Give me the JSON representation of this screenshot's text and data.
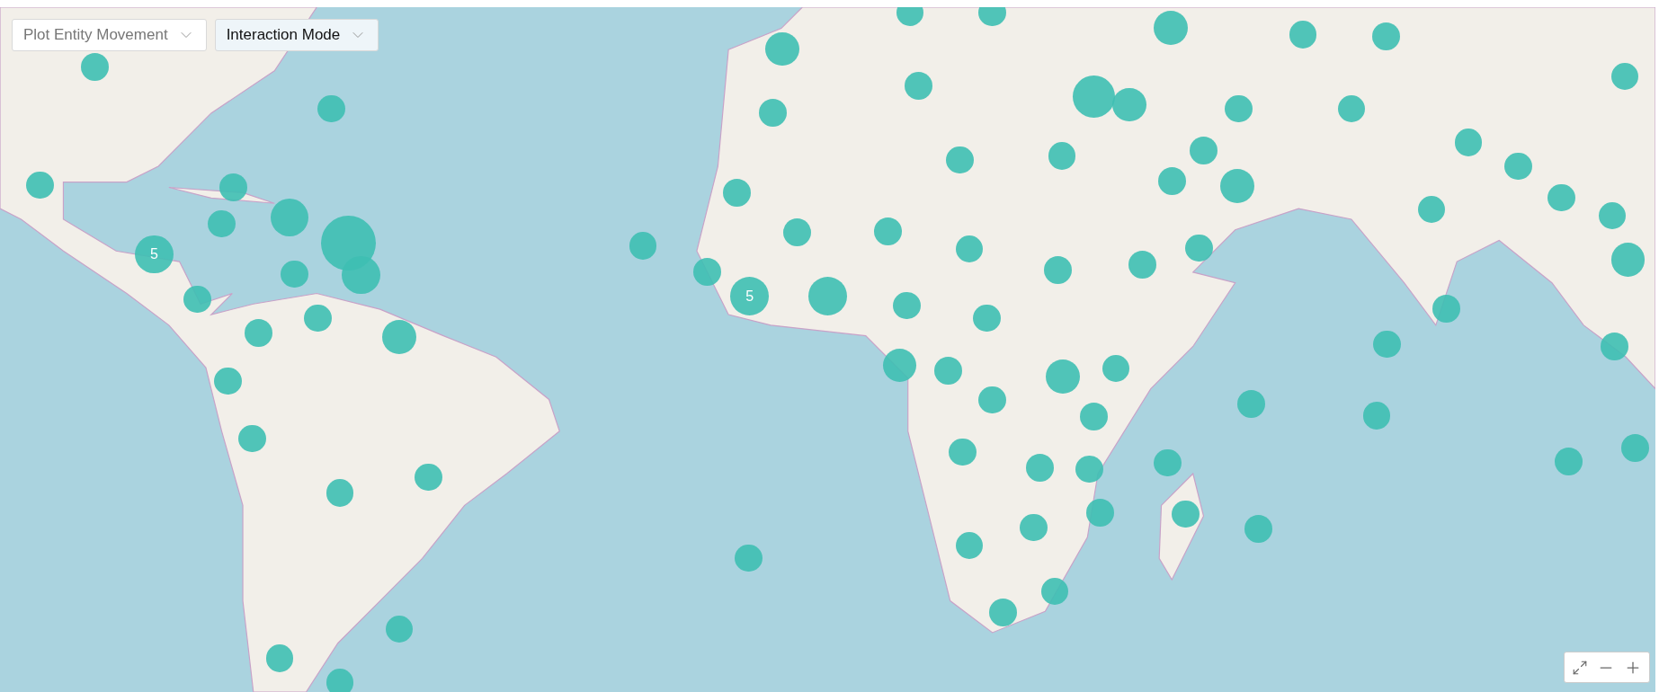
{
  "toolbar": [
    {
      "label": "Plot Entity Movement",
      "kind": "placeholder"
    },
    {
      "label": "Interaction Mode",
      "kind": "value"
    }
  ],
  "clusters": [
    {
      "label": "5"
    },
    {
      "label": "5"
    }
  ]
}
